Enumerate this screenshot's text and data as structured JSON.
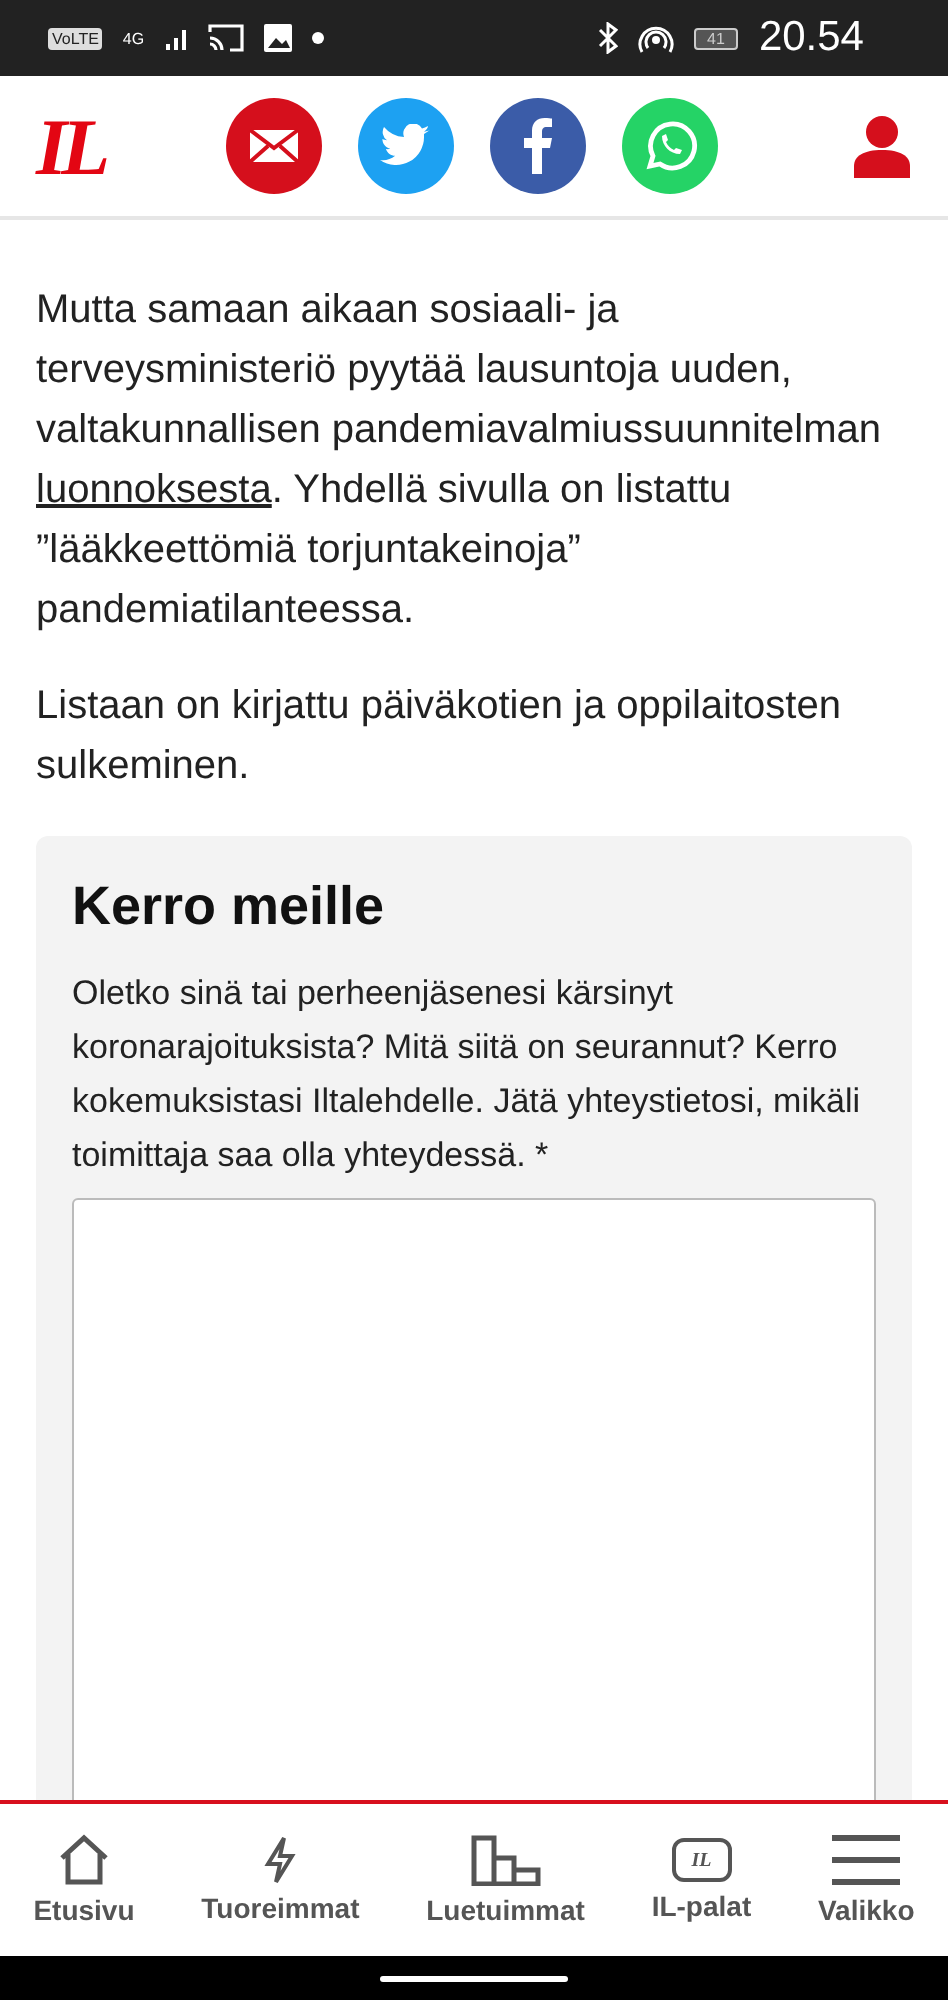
{
  "status_bar": {
    "network": "VoLTE",
    "signal_type": "4G",
    "battery": "41",
    "time": "20.54"
  },
  "header": {
    "logo": "IL"
  },
  "article": {
    "paragraphs": [
      {
        "text": "Mutta samaan aikaan sosiaali- ja terveysministeriö pyytää lausuntoja uuden, valtakunnallisen pandemiavalmiussuunnitelman",
        "link": "luonnoksesta",
        "after": ". Yhdellä sivulla on listattu ”lääkkeettömiä torjuntakeinoja” pandemiatilanteessa."
      },
      {
        "text": "Listaan on kirjattu päiväkotien ja oppilaitosten sulkeminen."
      }
    ]
  },
  "form": {
    "title": "Kerro meille",
    "prompt": "Oletko sinä tai perheenjäsenesi kärsinyt koronarajoituksista? Mitä siitä on seurannut? Kerro kokemuksistasi Iltalehdelle. Jätä yhteystietosi, mikäli toimittaja saa olla yhteydessä. *"
  },
  "bottom_nav": [
    {
      "label": "Etusivu",
      "kind": "home"
    },
    {
      "label": "Tuoreimmat",
      "kind": "bolt"
    },
    {
      "label": "Luetuimmat",
      "kind": "chart"
    },
    {
      "label": "IL-palat",
      "kind": "logo",
      "icon_text": "IL"
    },
    {
      "label": "Valikko",
      "kind": "menu"
    }
  ]
}
